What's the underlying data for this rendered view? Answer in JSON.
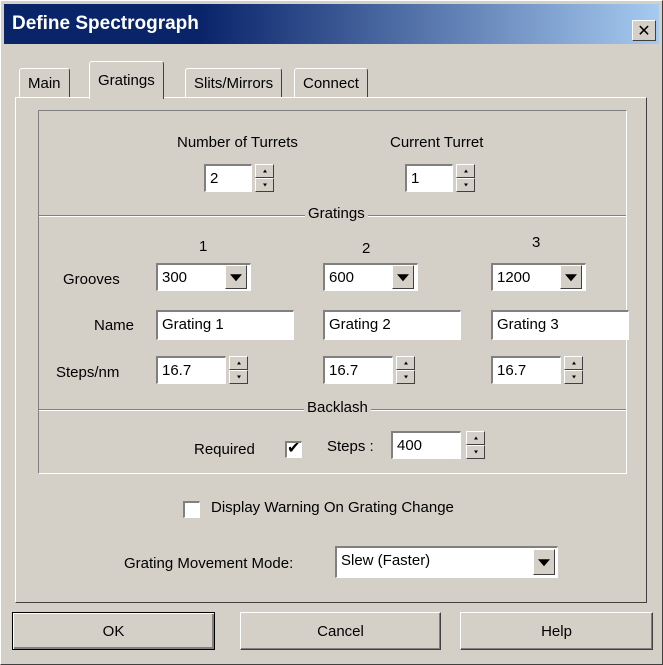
{
  "window": {
    "title": "Define Spectrograph",
    "close_symbol": "✕"
  },
  "tabs": [
    {
      "label": "Main"
    },
    {
      "label": "Gratings",
      "active": true
    },
    {
      "label": "Slits/Mirrors"
    },
    {
      "label": "Connect"
    }
  ],
  "turrets": {
    "number_label": "Number of Turrets",
    "number_value": "2",
    "current_label": "Current Turret",
    "current_value": "1"
  },
  "gratings": {
    "section_label": "Gratings",
    "columns": [
      "1",
      "2",
      "3"
    ],
    "grooves_label": "Grooves",
    "grooves": [
      "300",
      "600",
      "1200"
    ],
    "name_label": "Name",
    "names": [
      "Grating 1",
      "Grating 2",
      "Grating 3"
    ],
    "steps_label": "Steps/nm",
    "steps": [
      "16.7",
      "16.7",
      "16.7"
    ]
  },
  "backlash": {
    "section_label": "Backlash",
    "required_label": "Required",
    "required_checked": true,
    "checkmark": "✔",
    "steps_label": "Steps :",
    "steps_value": "400"
  },
  "display_warning": {
    "label": "Display Warning On Grating Change",
    "checked": false
  },
  "movement_mode": {
    "label": "Grating Movement Mode:",
    "value": "Slew (Faster)"
  },
  "buttons": {
    "ok": "OK",
    "cancel": "Cancel",
    "help": "Help"
  }
}
